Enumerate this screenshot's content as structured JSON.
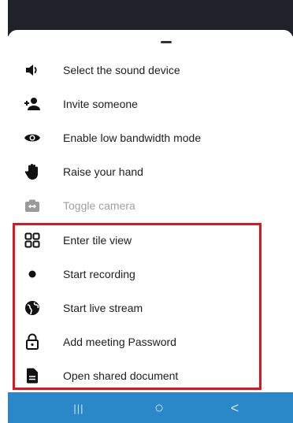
{
  "menu": {
    "items": [
      {
        "label": "Select the sound device",
        "icon": "speaker-icon"
      },
      {
        "label": "Invite someone",
        "icon": "add-person-icon"
      },
      {
        "label": "Enable low bandwidth mode",
        "icon": "eye-icon"
      },
      {
        "label": "Raise your hand",
        "icon": "hand-icon"
      },
      {
        "label": "Toggle camera",
        "icon": "camera-switch-icon",
        "disabled": true
      },
      {
        "label": "Enter tile view",
        "icon": "tile-grid-icon"
      },
      {
        "label": "Start recording",
        "icon": "record-icon"
      },
      {
        "label": "Start live stream",
        "icon": "globe-icon"
      },
      {
        "label": "Add meeting Password",
        "icon": "lock-icon"
      },
      {
        "label": "Open shared document",
        "icon": "document-icon"
      }
    ]
  },
  "navbar": {
    "recents_glyph": "|||",
    "home_glyph": "○",
    "back_glyph": "<"
  },
  "colors": {
    "highlight": "#e0141b",
    "navbar": "#2a87c8",
    "topbar": "#1f2329"
  }
}
